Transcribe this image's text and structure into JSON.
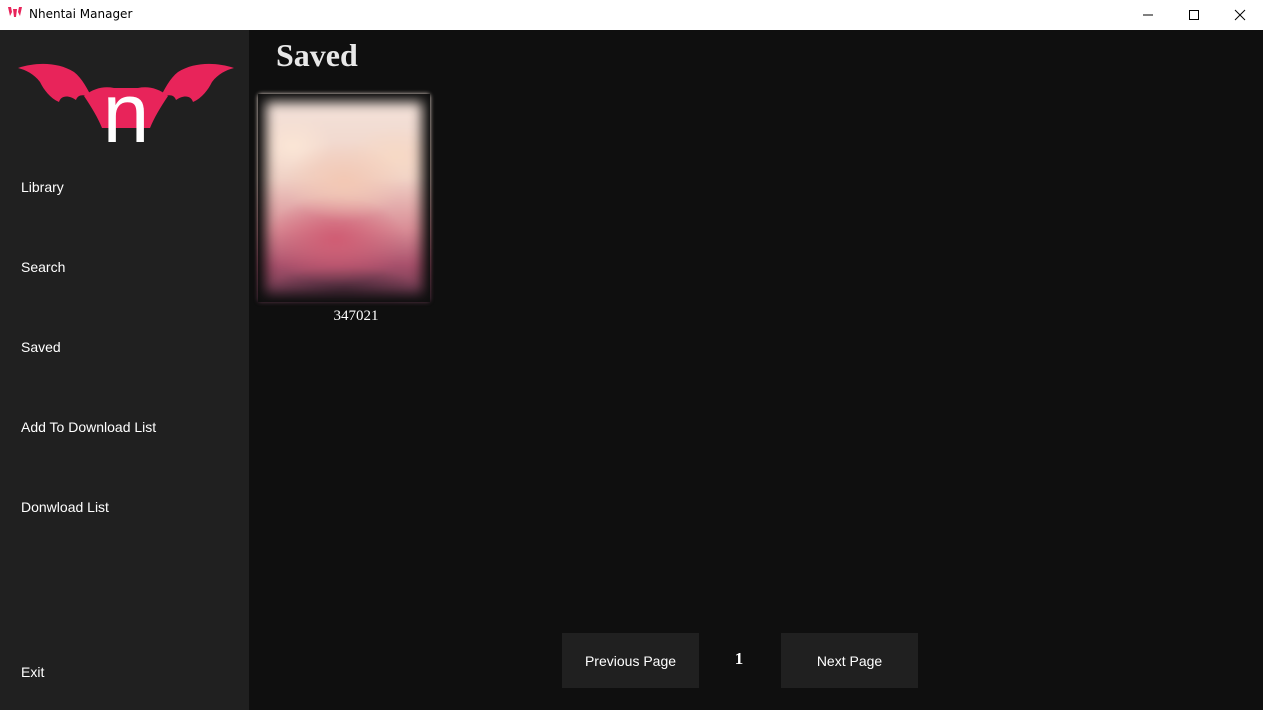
{
  "window": {
    "title": "Nhentai Manager"
  },
  "sidebar": {
    "logo_letter": "n",
    "items": [
      {
        "label": "Library"
      },
      {
        "label": "Search"
      },
      {
        "label": "Saved"
      },
      {
        "label": "Add To Download List"
      },
      {
        "label": "Donwload List"
      }
    ],
    "exit_label": "Exit"
  },
  "main": {
    "title": "Saved",
    "cards": [
      {
        "label": "347021"
      }
    ],
    "pager": {
      "previous_label": "Previous Page",
      "page_number": "1",
      "next_label": "Next Page"
    }
  },
  "colors": {
    "accent": "#e8245a",
    "sidebar_bg": "#202020",
    "main_bg": "#0f0f0f"
  }
}
